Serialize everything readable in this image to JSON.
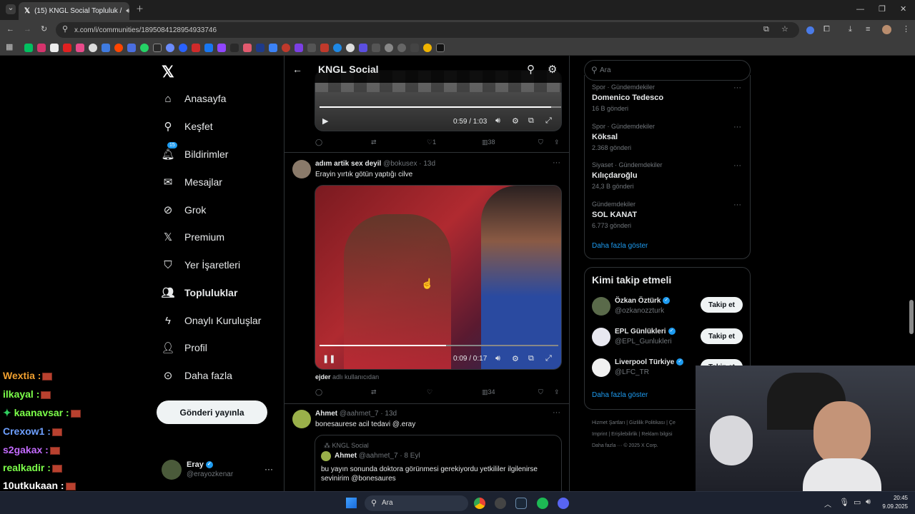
{
  "browser": {
    "tab_title": "(15) KNGL Social Topluluk /",
    "url": "x.com/i/communities/1895084128954933746"
  },
  "nav": {
    "items": [
      {
        "label": "Anasayfa",
        "icon": "home-icon"
      },
      {
        "label": "Keşfet",
        "icon": "search-icon"
      },
      {
        "label": "Bildirimler",
        "icon": "bell-icon",
        "badge": "15"
      },
      {
        "label": "Mesajlar",
        "icon": "mail-icon"
      },
      {
        "label": "Grok",
        "icon": "grok-icon"
      },
      {
        "label": "Premium",
        "icon": "x-icon"
      },
      {
        "label": "Yer İşaretleri",
        "icon": "bookmark-icon"
      },
      {
        "label": "Topluluklar",
        "icon": "communities-icon"
      },
      {
        "label": "Onaylı Kuruluşlar",
        "icon": "lightning-icon"
      },
      {
        "label": "Profil",
        "icon": "person-icon"
      },
      {
        "label": "Daha fazla",
        "icon": "more-circle-icon"
      }
    ],
    "post_button": "Gönderi yayınla",
    "account": {
      "name": "Eray",
      "handle": "@erayozkenar"
    }
  },
  "header": {
    "title": "KNGL Social"
  },
  "posts": [
    {
      "video_time": "0:59 / 1:03",
      "replies": "",
      "reposts": "",
      "likes": "1",
      "views": "38"
    },
    {
      "author": "adım artik sex deyil",
      "handle": "@bokusex",
      "age": "· 13d",
      "text": "Erayin yırtık götün yaptığı cilve",
      "video_time": "0:09 / 0:17",
      "video_progress": 0.53,
      "caption_user": "ejder",
      "caption_rest": "adlı kullanıcıdan",
      "likes": "",
      "views": "34"
    },
    {
      "author": "Ahmet",
      "handle": "@aahmet_7",
      "age": "· 13d",
      "text": "bonesaurese acil tedavi @.eray",
      "quote": {
        "community": "KNGL Social",
        "author": "Ahmet",
        "handle": "@aahmet_7",
        "age": "· 8 Eyl",
        "text": "bu yayın sonunda doktora görünmesi gerekiyordu yetkililer ilgilenirse sevinirim @bonesaures"
      }
    }
  ],
  "search": {
    "placeholder": "Ara"
  },
  "trends": [
    {
      "category": "Spor · Gündemdekiler",
      "name": "Domenico Tedesco",
      "count": "16 B gönderi"
    },
    {
      "category": "Spor · Gündemdekiler",
      "name": "Köksal",
      "count": "2.368 gönderi"
    },
    {
      "category": "Siyaset · Gündemdekiler",
      "name": "Kılıçdaroğlu",
      "count": "24,3 B gönderi"
    },
    {
      "category": "Gündemdekiler",
      "name": "SOL KANAT",
      "count": "6.773 gönderi"
    }
  ],
  "trends_more": "Daha fazla göster",
  "who_to_follow": {
    "title": "Kimi takip etmeli",
    "accounts": [
      {
        "name": "Özkan Öztürk",
        "handle": "@ozkanozzturk",
        "button": "Takip et"
      },
      {
        "name": "EPL Günlükleri",
        "handle": "@EPL_Gunlukleri",
        "button": "Takip et"
      },
      {
        "name": "Liverpool Türkiye",
        "handle": "@LFC_TR",
        "button": "Takip et"
      }
    ],
    "more": "Daha fazla göster"
  },
  "footer": {
    "links": [
      "Hizmet Şartları",
      "Gizlilik Politikası",
      "Çe",
      "Imprint",
      "Erişilebilirlik",
      "Reklam bilgisi",
      "Daha fazla ···"
    ],
    "copyright": "© 2025 X Corp."
  },
  "chat": [
    {
      "user": "Wextia :",
      "color": "#f0a030"
    },
    {
      "user": "ilkayal :",
      "color": "#7cff4a"
    },
    {
      "user": "kaanavsar :",
      "color": "#7cff4a",
      "prefix": "✦"
    },
    {
      "user": "Crexow1 :",
      "color": "#6ea0ff"
    },
    {
      "user": "s2gakax :",
      "color": "#c46bff"
    },
    {
      "user": "realkadir :",
      "color": "#7cff4a"
    },
    {
      "user": "10utkukaan :",
      "color": "#ffffff"
    }
  ],
  "taskbar": {
    "search": "Ara",
    "time": "20:45",
    "date": "9.09.2025"
  }
}
